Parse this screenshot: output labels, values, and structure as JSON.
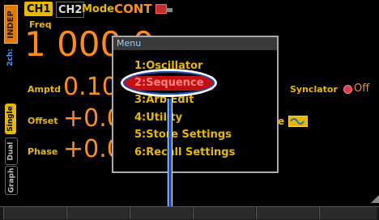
{
  "header": {
    "ch1": "CH1",
    "ch2": "CH2",
    "mode_label": "Mode",
    "mode_value": "CONT"
  },
  "left": {
    "indep": "INDEP",
    "ch2_label": "2ch:",
    "tabs": [
      "Single",
      "Dual",
      "Graph"
    ]
  },
  "params": {
    "freq_label": "Freq",
    "freq_value": "1 000.0",
    "amptd_label": "Amptd",
    "amptd_value": "0.10",
    "offset_label": "Offset",
    "offset_value": "+0.0",
    "phase_label": "Phase",
    "phase_value": "+0.0",
    "synclator_label": "Synclator",
    "synclator_value": "Off",
    "wave_label_stub": "e"
  },
  "menu": {
    "title": "Menu",
    "items": [
      "1:Oscillator",
      "2:Sequence",
      "3:Arb Edit",
      "4:Utility",
      "5:Store Settings",
      "6:Recall Settings"
    ],
    "selected_index": 1
  },
  "colors": {
    "accent_yellow": "#e8b800",
    "value_orange": "#ff8c1a",
    "annotation_blue": "#1a4fbf",
    "selection_red": "#c01010"
  }
}
